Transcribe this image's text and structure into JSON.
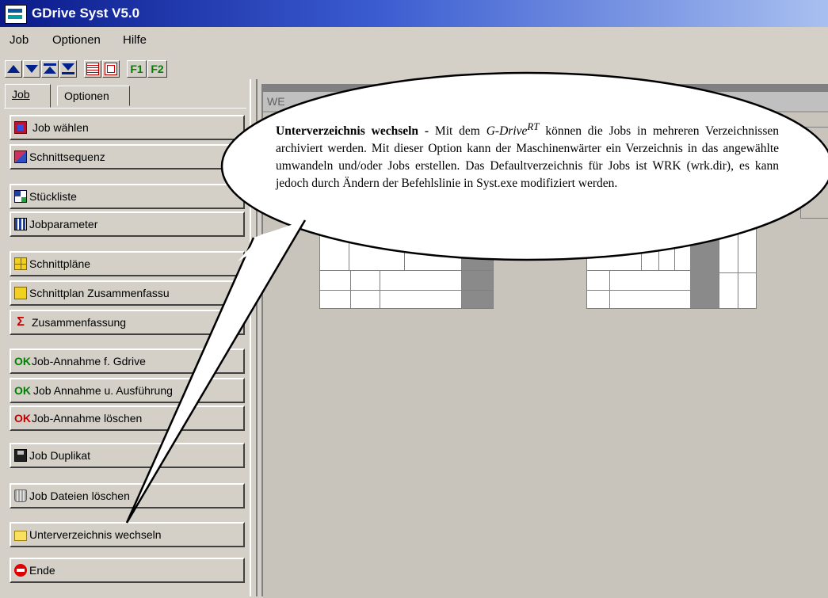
{
  "window": {
    "title": "GDrive Syst V5.0"
  },
  "menu": {
    "items": [
      "Job",
      "Optionen",
      "Hilfe"
    ]
  },
  "toolbar": {
    "f1": "F1",
    "f2": "F2"
  },
  "tabs": [
    {
      "label": "Job",
      "active": true
    },
    {
      "label": "Optionen",
      "active": false
    }
  ],
  "sidebar": {
    "buttons": [
      {
        "label": "Job wählen",
        "icon": "job-select-icon"
      },
      {
        "label": "Schnittsequenz",
        "icon": "cut-sequence-icon"
      },
      {
        "label": "Stückliste",
        "icon": "parts-list-icon"
      },
      {
        "label": "Jobparameter",
        "icon": "job-parameter-icon"
      },
      {
        "label": "Schnittpläne",
        "icon": "cut-plans-icon"
      },
      {
        "label": "Schnittplan Zusammenfassu",
        "icon": "cut-plan-summary-icon"
      },
      {
        "label": "Zusammenfassung",
        "icon": "sigma-icon"
      },
      {
        "label": "Job-Annahme f. Gdrive",
        "icon": "ok-icon"
      },
      {
        "label": "Job Annahme u. Ausführung",
        "icon": "ok-check-icon"
      },
      {
        "label": "Job-Annahme löschen",
        "icon": "ok-cross-icon"
      },
      {
        "label": "Job Duplikat",
        "icon": "floppy-icon"
      },
      {
        "label": "Job Dateien löschen",
        "icon": "trash-icon"
      },
      {
        "label": "Unterverzeichnis wechseln",
        "icon": "folder-icon"
      },
      {
        "label": "Ende",
        "icon": "stop-icon"
      }
    ]
  },
  "main": {
    "inner_title": "WE"
  },
  "callout": {
    "heading": "Unterverzeichnis wechseln -",
    "intro": "Mit dem",
    "product": "G-Drive",
    "product_sup": "RT",
    "body": "können die Jobs in mehreren Verzeichnissen archiviert werden. Mit dieser Option kann der Maschinenwärter ein Verzeichnis in das angewählte umwandeln und/oder Jobs erstellen. Das Defaultverzeichnis für Jobs ist WRK (wrk.dir), es kann jedoch durch Ändern der Befehlslinie in Syst.exe modifiziert werden."
  },
  "colors": {
    "titlebar": "#0a1a8a",
    "face": "#d4d0c8",
    "workspace": "#808080",
    "ok": "#008000"
  }
}
